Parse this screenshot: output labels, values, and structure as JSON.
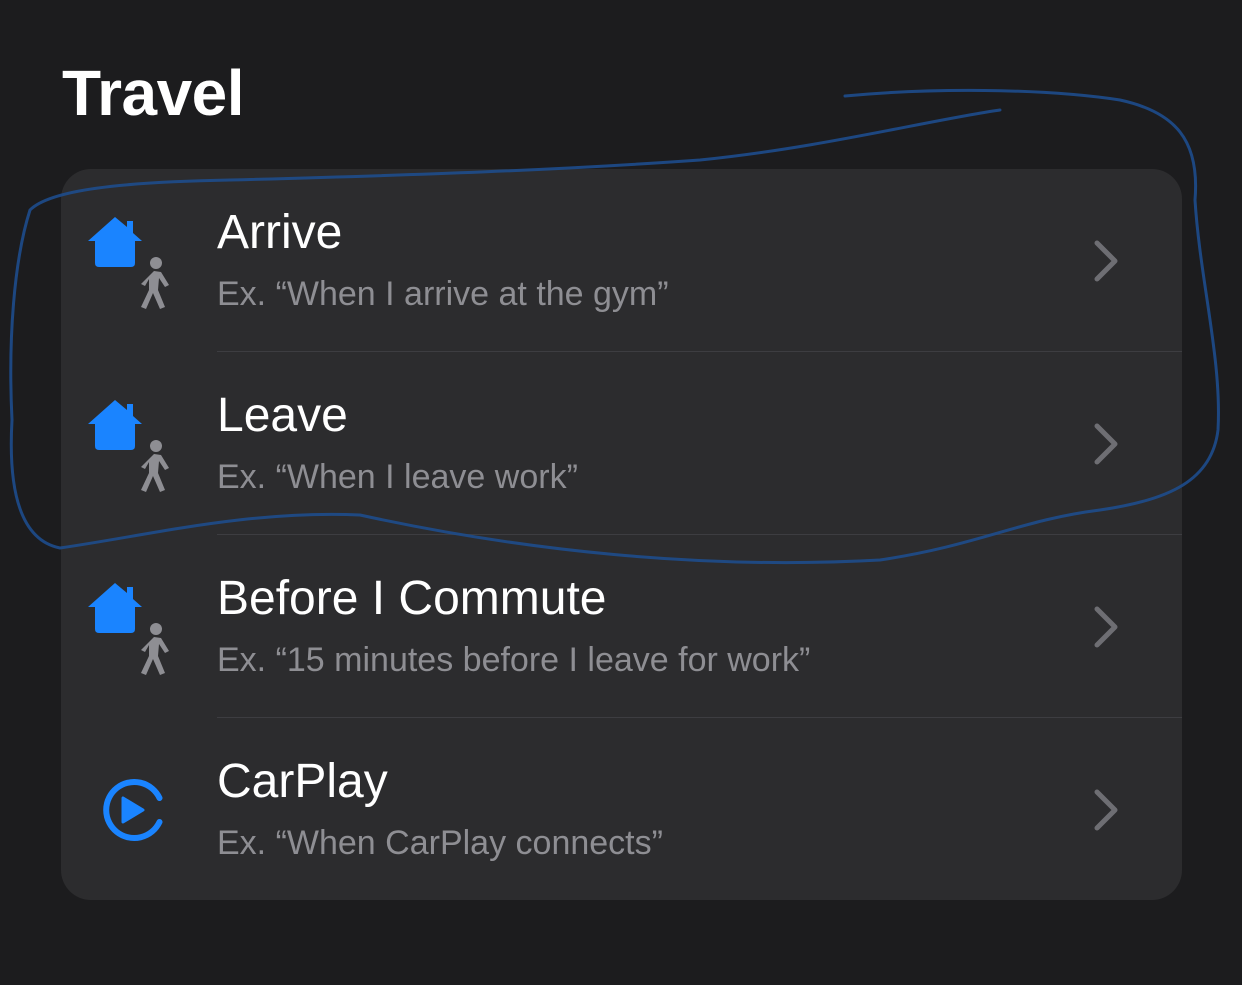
{
  "section": {
    "title": "Travel"
  },
  "rows": [
    {
      "title": "Arrive",
      "subtitle": "Ex. “When I arrive at the gym”",
      "icon": "home-walk-icon"
    },
    {
      "title": "Leave",
      "subtitle": "Ex. “When I leave work”",
      "icon": "home-walk-icon"
    },
    {
      "title": "Before I Commute",
      "subtitle": "Ex. “15 minutes before I leave for work”",
      "icon": "home-walk-icon"
    },
    {
      "title": "CarPlay",
      "subtitle": "Ex. “When CarPlay connects”",
      "icon": "carplay-icon"
    }
  ],
  "colors": {
    "background": "#1c1c1e",
    "card": "#2c2c2e",
    "accent": "#1a84ff",
    "walker": "#8e8e93",
    "subtitle": "#8e8e93",
    "annotation": "#1e4d8c"
  }
}
